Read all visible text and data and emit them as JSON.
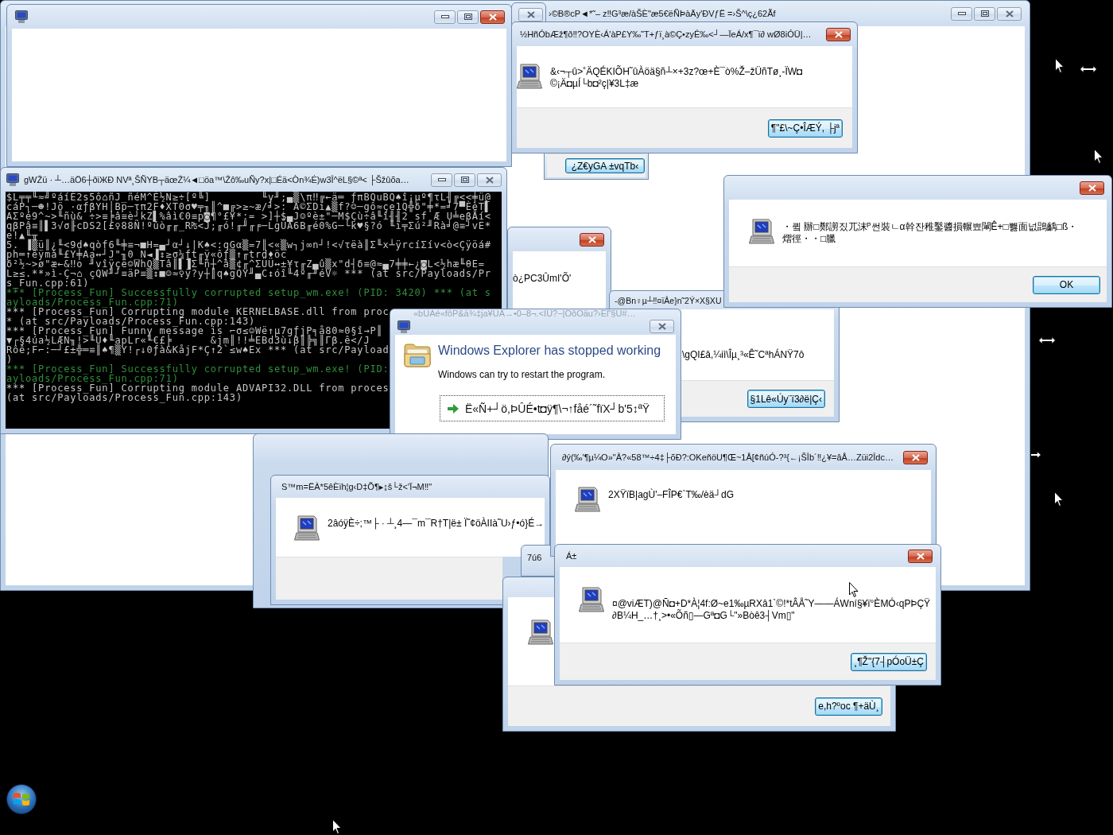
{
  "windows": [
    {
      "kind": "blank",
      "title": "›©B®cP◄*˜– z‼G³æ/àŠÈ\"æ5€ëÑÞàÄy'ÐVƒË =›Š^\\ç¿62Ãf",
      "active": false
    },
    {
      "kind": "fragment",
      "active": false
    },
    {
      "kind": "blank",
      "active": true
    },
    {
      "kind": "message",
      "title": "½HñÓbÆž¶ð‼?OYÈ‹Á'àP£Y‰˜T+ƒï¸à©Ç•zyÊ‰<┘—ÏeÁ/x¶¯ï∂ wØ8iÓÜ|…",
      "active": true,
      "message": [
        "&‹¬┬û>˚ÄQÉKIÕH˜ûÀöä§ñ┴×+3z?œ+È¯ò%Ž–žÜñTø¸-ÏW◘",
        "©¡Ä◘µÍ└b◘²ç|¥3L‡æ"
      ],
      "button": "¶\"£\\~Ç•ÎÆÝ, ├jª"
    },
    {
      "kind": "message",
      "button": "¿Z€yGA  ±vqTb‹"
    },
    {
      "kind": "console",
      "title": "gWŽü · ┴…äÖ6┼ðiЖÐ  NVª¸ŠÑYB┬äœŽ¼◄□öa™\\Žô‰uÑy?x|□Éä<Òn¾Ė)w3Î^ëL§©ª< ├Šžûõa…",
      "active": false,
      "lines": [
        {
          "kind": "plain",
          "text": "$L╤╤╙≈╝ºáíÉ2s5ô⌂ñJ_ñéM^É½N≥÷[º╚]        ╙y╜;▄▒\\π‼╔←ä═ ƒπBQuBQ♠î¡µº¶τL╢╔<<╪ü@"
        },
        {
          "kind": "plain",
          "text": "cáP┐─☻!Jö ·αƒβYH│Bp─τπ2F♦XT0σ♥╤╖║^■╔>≥~æ/╛>: A©ΣDi▲▒f?☺─gô≈çe1Q╬δ\"╪*=╛7▀ÈèT▌"
        },
        {
          "kind": "plain",
          "text": "AΣºé9^~>╙ñù& ÷>≡╞â≡è┘kZ▌%âì€0≡p◙¶°£¥*:= >]┼$▄J☺ºè±\"─M$Çù÷â╙î╢╢2 sf Æ U╧eβÅí<"
        },
        {
          "kind": "plain",
          "text": "qβPâ≡║▌3√σ╟cDS2[£♀88Ñ!ºúò╓╓_R₧<J;╓ó!╓╜╓╒─LgÜA6B╓é0%G─└k♥§?ó ╙ï╤Σú²╜Rà╛@≡┘vE*"
        },
        {
          "kind": "plain",
          "text": "e!▲╙╥"
        },
        {
          "kind": "plain",
          "text": "5. ▐▒ü║¿╙<9d♠qòf6╙╪≡¬■H=▄┘α┘↓|K♠<:qGα▒=7║<«▒w┐j∞n┘!<√τëà║Σ╙x┴ÿrcíΣív<ò<Çÿöá#"
        },
        {
          "kind": "plain",
          "text": "ph═↑êÿmà╙£Y╪Aa↔┘J\"╖0_N◄▐↕≥σ¼ƒt╓ÿ«ôƒ▒↑╓trd♦öc"
        },
        {
          "kind": "plain",
          "text": "δ²½~>ø\"æ←&‼o ╜vîÿçë☺WhQ▒Tâ║▌▐Σ╙ñ┼^â▒¢╓^ΣÜÜ↔±¥τ╓Z▄û▒x\"d┤δ≡@≈▄7╪╪←¿◙L<½hæ╙θE="
        },
        {
          "kind": "plain",
          "text": "L≥≤.**»ì-Ç¬⌂ çQW╜┘≡äP≡▒↕■☺≈♀ÿ?y┼║q♠gQY╜▄C↕óî╙4º╓╜éV☼ *** (at src/Payloads/Pr"
        },
        {
          "kind": "plain",
          "text": "s_Fun.cpp:61)"
        },
        {
          "kind": "success",
          "text": "*** [Process_Fun] Successfully corrupted setup_wm.exe! (PID: 3420) *** (at s"
        },
        {
          "kind": "success",
          "text": "ayloads/Process_Fun.cpp:71)"
        },
        {
          "kind": "plain",
          "text": "*** [Process_Fun] Corrupting module KERNELBASE.dll from proc"
        },
        {
          "kind": "plain",
          "text": "* (at src/Payloads/Process_Fun.cpp:143)"
        },
        {
          "kind": "plain",
          "text": "*** [Process_Fun] Funny message is ⌐σ≤☺Wë↑µ7gƒjP╕å80≈0§î→P║"
        },
        {
          "kind": "plain",
          "text": "▼┌§4úa½LÆN╖!>╙Ü♦╙apLr«╙€£╞      &jm║!!╧EBd3ù↓β║╠╗║Γβ.ê</J"
        },
        {
          "kind": "plain",
          "text": "Rôê;F⌐:─┘£±╬═≡║♠¶▒Y!┌↓0ƒà&KåjF*Ç↑2`≤w♠Ex *** (at src/Payload"
        },
        {
          "kind": "plain",
          "text": ")"
        },
        {
          "kind": "success",
          "text": "*** [Process_Fun] Successfully corrupted setup_wm.exe! (PID:"
        },
        {
          "kind": "success",
          "text": "ayloads/Process_Fun.cpp:71)"
        },
        {
          "kind": "plain",
          "text": "*** [Process_Fun] Corrupting module ADVAPI32.DLL from proces"
        },
        {
          "kind": "plain",
          "text": "(at src/Payloads/Process_Fun.cpp:143)"
        }
      ]
    },
    {
      "kind": "message",
      "active": true,
      "message": [
        "ò¿PC3ÛmI'Õ'"
      ]
    },
    {
      "kind": "message",
      "title": "-@Bn♀µ┴‼¤ïÂe}n˜2Ý×X§XU",
      "message": [
        "\\gQI£â,¼iì\\Îµ¸³«Ê˜CªhÁNŸ7ô"
      ],
      "button": "§1Lê«Úy¨ï3∂ë|Ç‹"
    },
    {
      "kind": "message",
      "active": true,
      "message": [
        "・큌 辦□鄭謭짔兀沫ᴾ썬裝ㄴα幹잔稚鑿醬損輾뾰閳Ê+□뾇面넚鵾齲□ß・",
        "熠徑・・□臘"
      ],
      "button": "OK"
    },
    {
      "kind": "error_report",
      "title": "«bÙAé«fôP&ä¾‡ja¥UA→•0–8¬.<IÛ?−|ÓôOäu?›Eľ'§U#…",
      "active": false,
      "heading": "Windows Explorer has stopped working",
      "description": "Windows can try to restart the program.",
      "action": "Ë«Ñ+┘ö,ÞÛÉ•t◘ÿ¶\\¬↑fåé´˜fïX┘b'5↕ªŸ"
    },
    {
      "kind": "fragment"
    },
    {
      "kind": "message",
      "title": "S™m=ËÀ*5êÈïh¦g‹D‡Õ¶▸↨š└ž<'Ï¬M‼\"",
      "message": [
        "2âóÿÈ÷;™├ · ┴¸4—¯m¯R†T|ë± Ï˜¢öÀIIà˜U›ƒ•ó}É→"
      ]
    },
    {
      "kind": "fragment",
      "title": "7ú6"
    },
    {
      "kind": "message",
      "title": "∂ý(‰'¶µ¼O»\"Â?«58™÷4‡├õÐ?:OKeñöU¶Œ~1Å[¢ñúÓ-?³{←¡ŠÎb´‼¿¥=âÅ…Züi2Îdc…",
      "active": true,
      "message": [
        "2XŸïB|agÙ'–FÎP€`T‰/èä┘dG"
      ]
    },
    {
      "kind": "message",
      "button": "e,h?ºoc  ¶+äÙ¸"
    },
    {
      "kind": "message",
      "title": "Á±",
      "active": true,
      "message": [
        "¤@viÆT)@Ñ◘+D*À¦4f:Ø~e1‰µRXâ1`©!*tÂÅ˜Y——ÁWní§¥ï°ÈMÓ‹qPÞÇŸ",
        "∂B¼H_…†¸>•«Õñ▯—Gª◘G└\"»Bòê3┤Vm▯\""
      ],
      "button": "¸¶Ž\"{7┤pÓoÜ±Ç"
    }
  ]
}
